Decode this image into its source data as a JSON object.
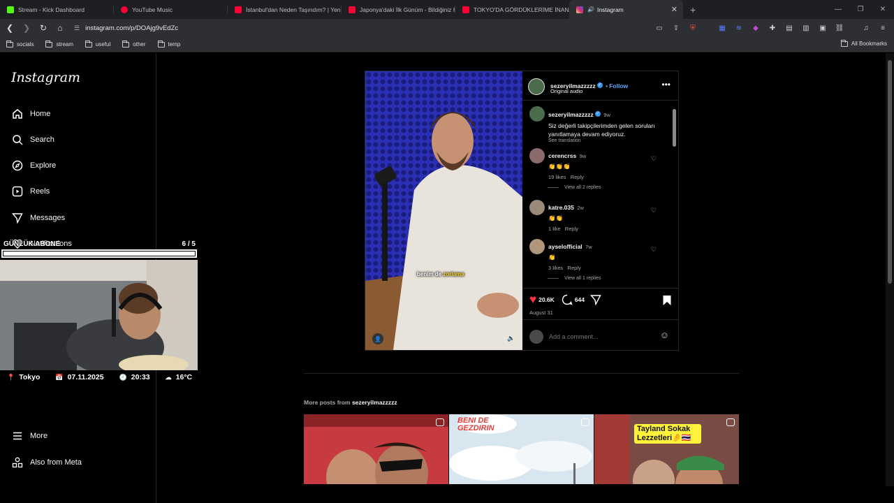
{
  "browser": {
    "tabs": [
      {
        "title": "Stream - Kick Dashboard",
        "color": "#53fc18"
      },
      {
        "title": "YouTube Music",
        "color": "#ff0033"
      },
      {
        "title": "İstanbul'dan Neden Taşındım? | Yeni",
        "color": "#ff0033"
      },
      {
        "title": "Japonya'daki İlk Günüm - Bildiğiniz H",
        "color": "#ff0033"
      },
      {
        "title": "TOKYO'DA GÖRDÜKLERİME İNANAM",
        "color": "#ff0033"
      },
      {
        "title": "Instagram",
        "color": "#d62976"
      }
    ],
    "url": "instagram.com/p/DOAjg9vEdZc",
    "bookmarks": [
      "socials",
      "stream",
      "useful",
      "other",
      "temp"
    ],
    "all_bookmarks": "All Bookmarks"
  },
  "sidebar": {
    "logo": "Instagram",
    "items": [
      {
        "label": "Home",
        "icon": "home-icon"
      },
      {
        "label": "Search",
        "icon": "search-icon"
      },
      {
        "label": "Explore",
        "icon": "compass-icon"
      },
      {
        "label": "Reels",
        "icon": "reels-icon"
      },
      {
        "label": "Messages",
        "icon": "messages-icon"
      },
      {
        "label": "Notifications",
        "icon": "heart-icon"
      }
    ],
    "more": "More",
    "also_meta": "Also from Meta"
  },
  "overlay": {
    "subs_label": "GÜNLÜK ABONE",
    "subs_count": "6  /  5",
    "subs_progress": 1.0,
    "location": "Tokyo",
    "date": "07.11.2025",
    "time": "20:33",
    "weather": "16°C"
  },
  "post": {
    "username": "sezeryilmazzzzz",
    "follow": "Follow",
    "audio": "Original audio",
    "video_caption_a": "benim de ",
    "video_caption_b": "zorlama",
    "caption": {
      "username": "sezeryilmazzzzz",
      "age": "9w",
      "text": "Siz değerli takipçilerimden gelen soruları yanıtlamaya devam ediyoruz.",
      "see_translation": "See translation"
    },
    "comments": [
      {
        "username": "cerencrss",
        "age": "9w",
        "text": "👏👏👏",
        "likes": "19 likes",
        "reply": "Reply",
        "view_replies": "View all 2 replies"
      },
      {
        "username": "katre.035",
        "age": "2w",
        "text": "👏👏",
        "likes": "1 like",
        "reply": "Reply",
        "view_replies": ""
      },
      {
        "username": "ayselofficial",
        "age": "7w",
        "text": "👏",
        "likes": "3 likes",
        "reply": "Reply",
        "view_replies": "View all 1 replies"
      }
    ],
    "like_count": "20.6K",
    "comment_count": "644",
    "date": "August 31",
    "add_comment_placeholder": "Add a comment..."
  },
  "more_posts": {
    "prefix": "More posts from ",
    "username": "sezeryilmazzzzz",
    "thumbs": [
      {
        "caption": ""
      },
      {
        "caption": "BENI DE GEZDIRIN"
      },
      {
        "caption": "Tayland Sokak Lezzetleri🤌🇹🇭"
      }
    ]
  }
}
